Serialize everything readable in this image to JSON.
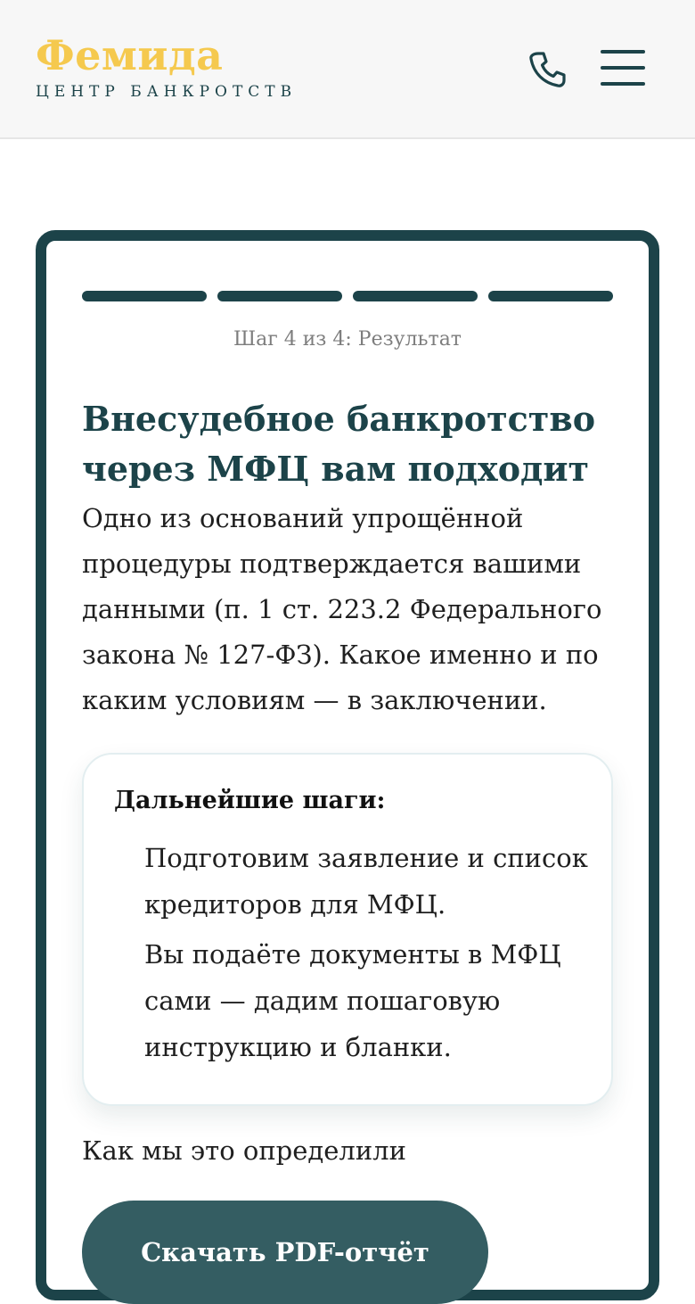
{
  "header": {
    "logo_title": "Фемида",
    "logo_subtitle": "ЦЕНТР БАНКРОТСТВ",
    "phone_icon": "phone-icon",
    "menu_icon": "hamburger-menu-icon"
  },
  "quiz": {
    "progress": {
      "current_step": 4,
      "total_steps": 4
    },
    "step_label": "Шаг 4 из 4: Результат",
    "result_title": "Внесудебное банкротство через МФЦ вам подходит",
    "result_text": "Одно из оснований упрощённой процедуры подтверждается вашими данными (п. 1 ст. 223.2 Федерального закона № 127-ФЗ). Какое именно и по каким условиям — в заключении.",
    "next_steps": {
      "title": "Дальнейшие шаги:",
      "items": [
        "Подготовим заявление и список кредиторов для МФЦ.",
        "Вы подаёте документы в МФЦ сами — дадим пошаговую инструкцию и бланки."
      ]
    },
    "how_link": "Как мы это определили",
    "download_button": "Скачать PDF-отчёт"
  },
  "colors": {
    "brand_dark": "#1c4349",
    "brand_gold": "#f5c94e",
    "button": "#345d62"
  }
}
